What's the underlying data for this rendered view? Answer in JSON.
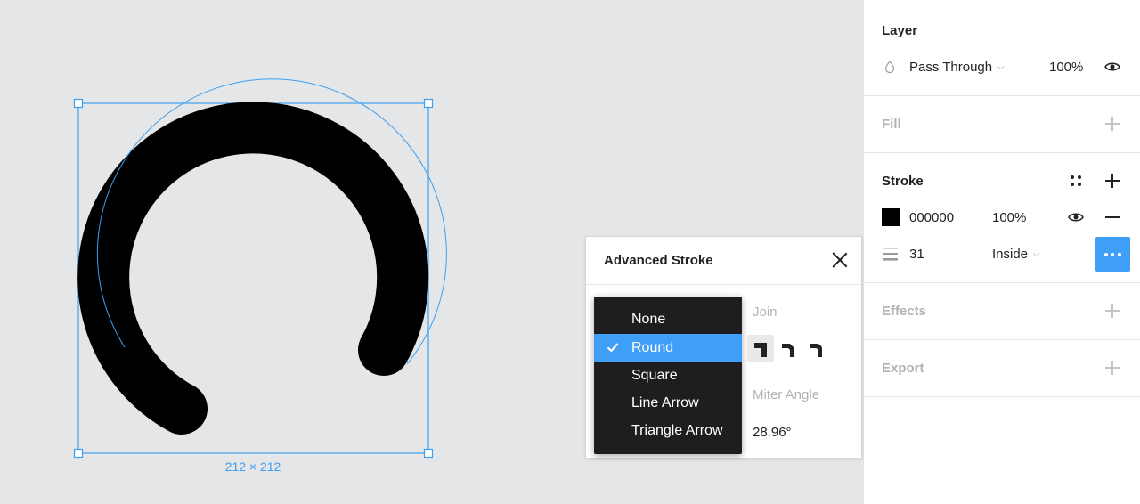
{
  "canvas": {
    "selection_size_label": "212 × 212"
  },
  "layer": {
    "title": "Layer",
    "blend_icon": "drop-icon",
    "blend_mode": "Pass Through",
    "opacity": "100%",
    "visibility_icon": "eye-icon"
  },
  "fill": {
    "title": "Fill",
    "add_icon": "plus-icon"
  },
  "stroke": {
    "title": "Stroke",
    "styles_icon": "style-grid-icon",
    "add_icon": "plus-icon",
    "color_hex": "000000",
    "color_swatch": "#000000",
    "opacity": "100%",
    "visibility_icon": "eye-icon",
    "remove_icon": "minus-icon",
    "weight_icon": "stroke-weight-icon",
    "weight": "31",
    "position": "Inside",
    "more_icon": "more-icon"
  },
  "effects": {
    "title": "Effects",
    "add_icon": "plus-icon"
  },
  "export": {
    "title": "Export",
    "add_icon": "plus-icon"
  },
  "advanced_stroke": {
    "title": "Advanced Stroke",
    "close_icon": "close-icon",
    "join_label": "Join",
    "join_options": [
      "miter-join-icon",
      "bevel-join-icon",
      "round-join-icon"
    ],
    "miter_angle_label": "Miter Angle",
    "miter_angle_value": "28.96°"
  },
  "cap_menu": {
    "selected": "Round",
    "items": [
      "None",
      "Round",
      "Square",
      "Line Arrow",
      "Triangle Arrow"
    ]
  },
  "colors": {
    "accent": "#3f9ef6",
    "selection": "#3c9ff1",
    "canvas_bg": "#e5e6e7",
    "menu_bg": "#1e1e1e"
  }
}
